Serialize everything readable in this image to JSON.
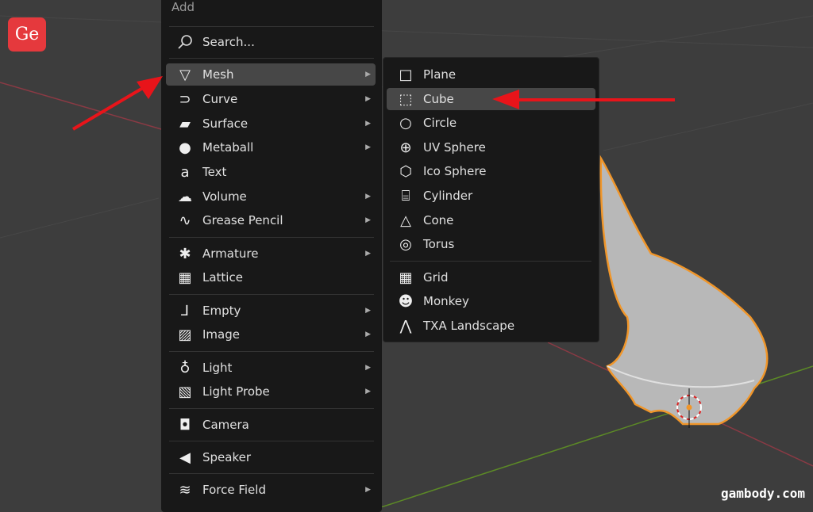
{
  "logo": "Ge",
  "watermark": "gambody.com",
  "menu": {
    "title": "Add",
    "search": "Search...",
    "items": [
      {
        "label": "Mesh",
        "icon": "mesh-icon",
        "sub": true
      },
      {
        "label": "Curve",
        "icon": "curve-icon",
        "sub": true
      },
      {
        "label": "Surface",
        "icon": "surface-icon",
        "sub": true
      },
      {
        "label": "Metaball",
        "icon": "metaball-icon",
        "sub": true
      },
      {
        "label": "Text",
        "icon": "text-icon",
        "sub": false
      },
      {
        "label": "Volume",
        "icon": "volume-icon",
        "sub": true
      },
      {
        "label": "Grease Pencil",
        "icon": "grease-pencil-icon",
        "sub": true
      },
      {
        "label": "Armature",
        "icon": "armature-icon",
        "sub": true
      },
      {
        "label": "Lattice",
        "icon": "lattice-icon",
        "sub": false
      },
      {
        "label": "Empty",
        "icon": "empty-icon",
        "sub": true
      },
      {
        "label": "Image",
        "icon": "image-icon",
        "sub": true
      },
      {
        "label": "Light",
        "icon": "light-icon",
        "sub": true
      },
      {
        "label": "Light Probe",
        "icon": "light-probe-icon",
        "sub": true
      },
      {
        "label": "Camera",
        "icon": "camera-icon",
        "sub": false
      },
      {
        "label": "Speaker",
        "icon": "speaker-icon",
        "sub": false
      },
      {
        "label": "Force Field",
        "icon": "force-field-icon",
        "sub": true
      }
    ]
  },
  "submenu": {
    "items": [
      {
        "label": "Plane",
        "icon": "plane-icon"
      },
      {
        "label": "Cube",
        "icon": "cube-icon"
      },
      {
        "label": "Circle",
        "icon": "circle-icon"
      },
      {
        "label": "UV Sphere",
        "icon": "uv-sphere-icon"
      },
      {
        "label": "Ico Sphere",
        "icon": "ico-sphere-icon"
      },
      {
        "label": "Cylinder",
        "icon": "cylinder-icon"
      },
      {
        "label": "Cone",
        "icon": "cone-icon"
      },
      {
        "label": "Torus",
        "icon": "torus-icon"
      },
      {
        "label": "Grid",
        "icon": "grid-icon"
      },
      {
        "label": "Monkey",
        "icon": "monkey-icon"
      },
      {
        "label": "TXA Landscape",
        "icon": "landscape-icon"
      }
    ]
  },
  "colors": {
    "highlight": "#474747",
    "selection_outline": "#f0962a",
    "x_axis": "#8a3a44",
    "y_axis": "#5c8a26",
    "annotation_arrow": "#e8141a"
  }
}
